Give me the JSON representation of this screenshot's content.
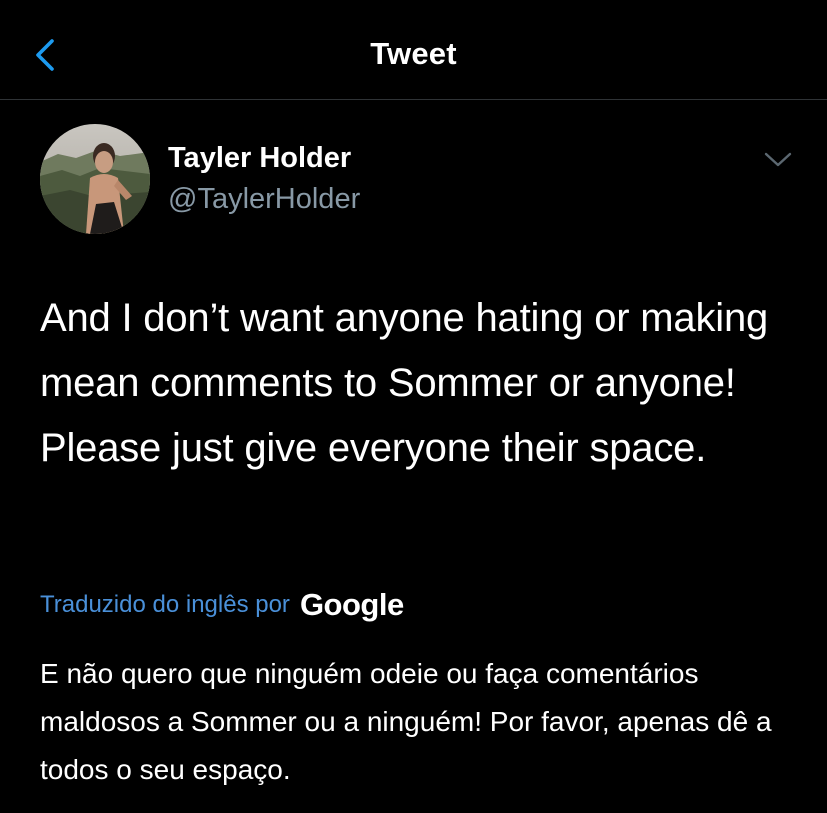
{
  "header": {
    "title": "Tweet",
    "back_icon": "chevron-left-icon"
  },
  "colors": {
    "background": "#000000",
    "accent": "#1d9bf0",
    "link": "#4a90d9",
    "secondary_text": "#8899a6"
  },
  "tweet": {
    "author": {
      "name": "Tayler Holder",
      "handle": "@TaylerHolder"
    },
    "more_icon": "chevron-down-icon",
    "text": "And I don’t want anyone hating or making mean comments to Sommer or anyone! Please just give everyone their space.",
    "translation": {
      "label": "Traduzido do inglês por",
      "provider": "Google",
      "text": "E não quero que ninguém odeie ou faça comentários maldosos a Sommer ou a ninguém! Por favor, apenas dê a todos o seu espaço."
    }
  }
}
